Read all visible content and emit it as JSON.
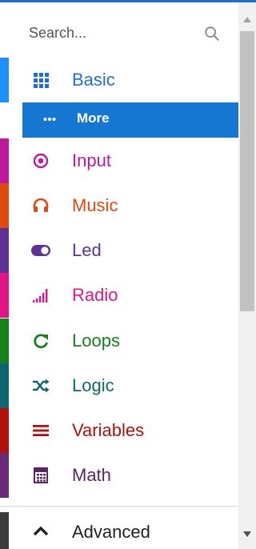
{
  "search": {
    "placeholder": "Search..."
  },
  "categories": [
    {
      "label": "Basic",
      "color": "#1e90ff",
      "icon": "grid-icon"
    },
    {
      "label": "Input",
      "color": "#c0189c",
      "icon": "target-icon"
    },
    {
      "label": "Music",
      "color": "#e04a10",
      "icon": "headphones-icon"
    },
    {
      "label": "Led",
      "color": "#5e3294",
      "icon": "toggle-icon"
    },
    {
      "label": "Radio",
      "color": "#e31486",
      "icon": "signal-bars-icon"
    },
    {
      "label": "Loops",
      "color": "#16801a",
      "icon": "refresh-icon"
    },
    {
      "label": "Logic",
      "color": "#0e6670",
      "icon": "shuffle-icon"
    },
    {
      "label": "Variables",
      "color": "#b4100b",
      "icon": "list-icon"
    },
    {
      "label": "Math",
      "color": "#6a2a77",
      "icon": "calculator-icon"
    },
    {
      "label": "Advanced",
      "color": "#3c3c3c",
      "icon": "chevron-up-icon"
    }
  ],
  "more": {
    "label": "More",
    "background": "#1677d2",
    "icon": "dots-icon"
  }
}
